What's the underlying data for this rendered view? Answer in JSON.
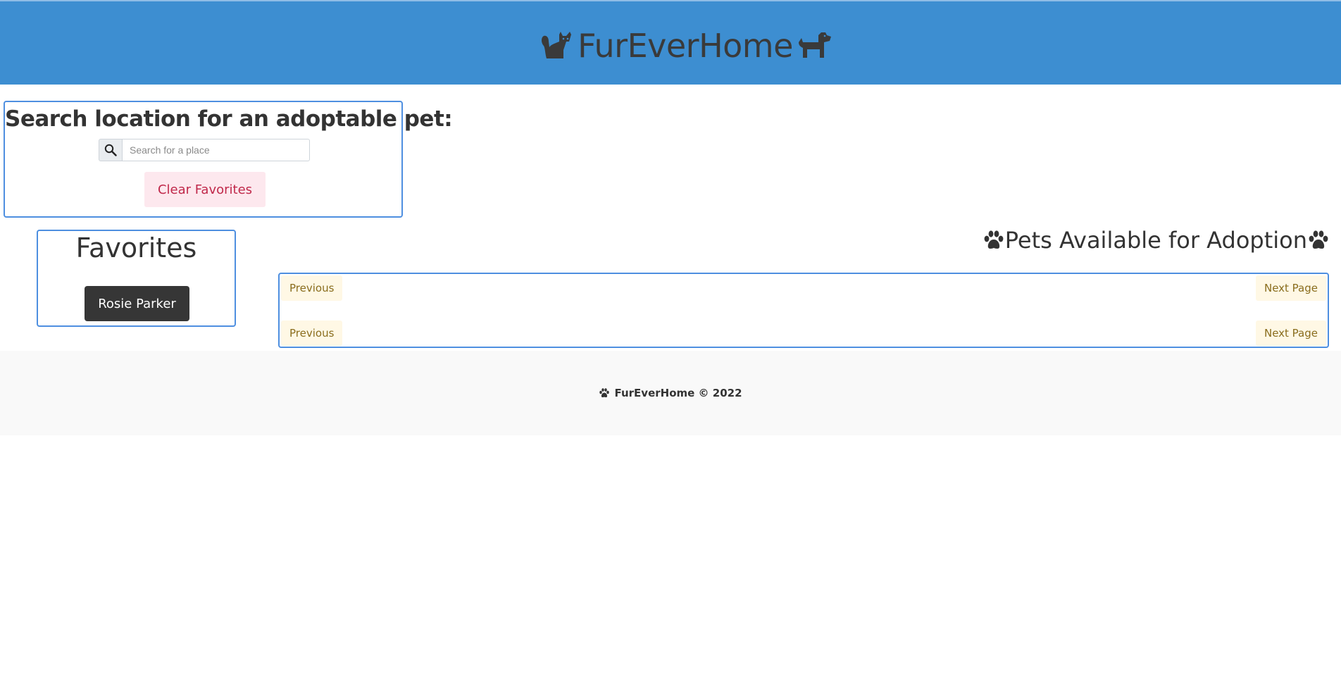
{
  "header": {
    "brand_title": "FurEverHome",
    "left_icon": "cat-icon",
    "right_icon": "dog-icon",
    "background_color": "#3d8ed1"
  },
  "search": {
    "heading": "Search location for an adoptable pet:",
    "placeholder": "Search for a place",
    "value": "",
    "icon": "search-icon",
    "clear_button_label": "Clear Favorites"
  },
  "favorites": {
    "heading": "Favorites",
    "items": [
      {
        "label": "Rosie Parker"
      }
    ]
  },
  "pets": {
    "heading": "Pets Available for Adoption",
    "heading_icon": "paw-icon",
    "pagination": {
      "previous_label": "Previous",
      "next_label": "Next Page"
    }
  },
  "footer": {
    "icon": "paw-icon",
    "text": "FurEverHome © 2022"
  },
  "colors": {
    "accent_border": "#4e8fe0",
    "clear_button_bg": "#fde8ee",
    "clear_button_text": "#c0284a",
    "pager_bg": "#fff8e5",
    "pager_text": "#8a6d1d",
    "favorite_bg": "#363636"
  }
}
